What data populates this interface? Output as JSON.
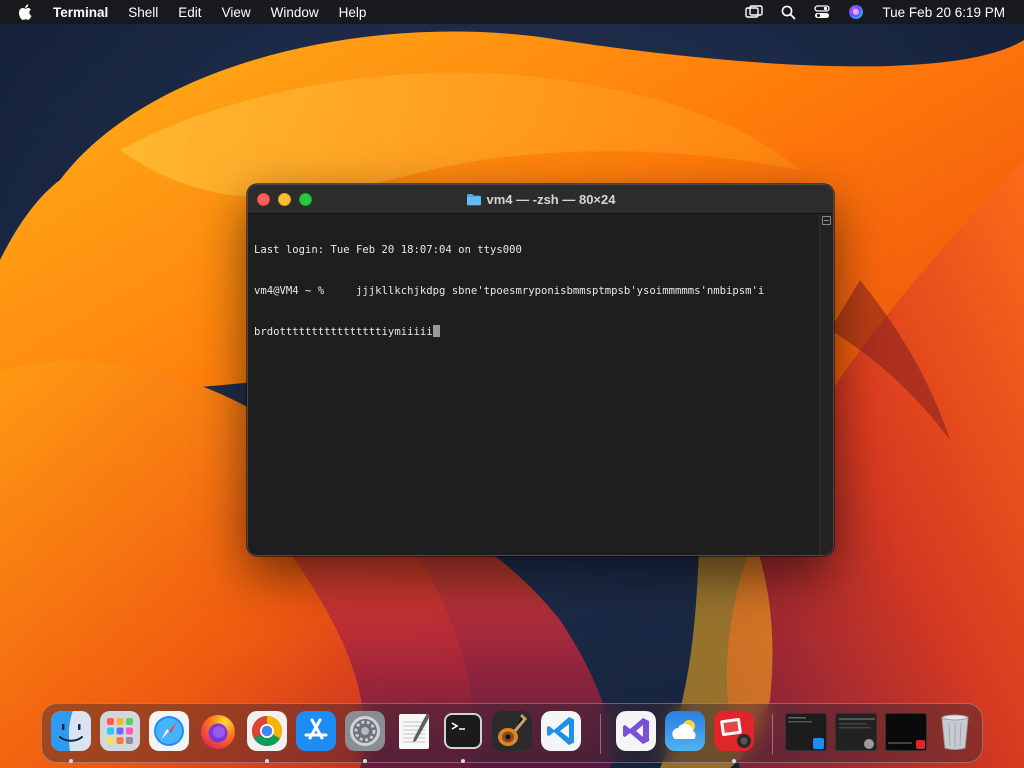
{
  "menubar": {
    "apple_icon": "apple-logo-icon",
    "app_name": "Terminal",
    "menus": [
      "Shell",
      "Edit",
      "View",
      "Window",
      "Help"
    ],
    "status_icons": [
      "screen-mirroring-icon",
      "spotlight-search-icon",
      "control-center-icon",
      "siri-icon"
    ],
    "clock": "Tue Feb 20  6:19 PM"
  },
  "window": {
    "title": "vm4 — -zsh — 80×24",
    "title_icon": "folder-icon",
    "lines": [
      "Last login: Tue Feb 20 18:07:04 on ttys000",
      "vm4@VM4 ~ %     jjjkllkchjkdpg sbne'tpoesmryponisbmmsptmpsb'ysoimmmmms'nmbipsm'i",
      "brdottttttttttttttttiymiiiii"
    ]
  },
  "dock": {
    "apps": [
      {
        "name": "Finder",
        "icon": "finder-icon",
        "running": true
      },
      {
        "name": "Launchpad",
        "icon": "launchpad-icon",
        "running": false
      },
      {
        "name": "Safari",
        "icon": "safari-icon",
        "running": false
      },
      {
        "name": "Firefox",
        "icon": "firefox-icon",
        "running": false
      },
      {
        "name": "Google Chrome",
        "icon": "chrome-icon",
        "running": true
      },
      {
        "name": "App Store",
        "icon": "app-store-icon",
        "running": false
      },
      {
        "name": "System Settings",
        "icon": "system-settings-icon",
        "running": true
      },
      {
        "name": "TextEdit",
        "icon": "textedit-icon",
        "running": false
      },
      {
        "name": "Terminal",
        "icon": "terminal-icon",
        "running": true
      },
      {
        "name": "GarageBand",
        "icon": "garageband-icon",
        "running": false
      },
      {
        "name": "Visual Studio Code",
        "icon": "vscode-icon",
        "running": false
      },
      {
        "name": "Visual Studio",
        "icon": "visual-studio-icon",
        "running": false
      },
      {
        "name": "Weather",
        "icon": "weather-icon",
        "running": false
      },
      {
        "name": "Photo Booth",
        "icon": "photo-booth-icon",
        "running": true
      }
    ],
    "minimized": [
      "minimized-window-1",
      "minimized-window-2",
      "minimized-window-3"
    ],
    "trash_icon": "trash-icon"
  }
}
